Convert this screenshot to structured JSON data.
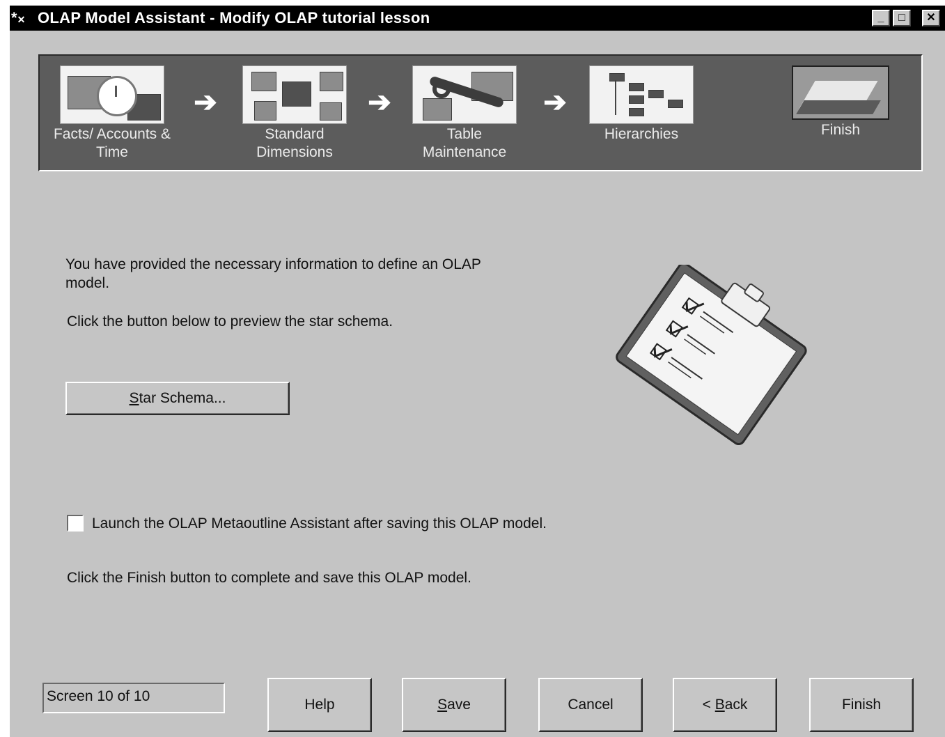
{
  "window": {
    "title": "OLAP Model Assistant - Modify OLAP tutorial lesson",
    "controls": {
      "minimize": "_",
      "maximize": "□",
      "close": "✕"
    }
  },
  "steps": [
    {
      "label": "Facts/ Accounts &\nTime",
      "icon": "facts-accounts-time-icon"
    },
    {
      "label": "Standard\nDimensions",
      "icon": "standard-dimensions-icon"
    },
    {
      "label": "Table\nMaintenance",
      "icon": "table-maintenance-icon"
    },
    {
      "label": "Hierarchies",
      "icon": "hierarchies-icon"
    },
    {
      "label": "Finish",
      "icon": "finish-icon"
    }
  ],
  "main": {
    "intro_text": "You have provided the necessary information to define an OLAP model.",
    "preview_text": "Click the button below to preview the star schema.",
    "star_schema_button": {
      "prefix": "S",
      "label": "tar Schema..."
    },
    "launch_checkbox": {
      "checked": false,
      "label": "Launch the OLAP Metaoutline Assistant after saving this OLAP model."
    },
    "finish_text": "Click the Finish button to complete and save this OLAP model."
  },
  "footer": {
    "status": "Screen 10 of 10",
    "buttons": {
      "help": "Help",
      "save_prefix": "S",
      "save_rest": "ave",
      "cancel": "Cancel",
      "back_lead": "< ",
      "back_accel": "B",
      "back_rest": "ack",
      "finish": "Finish"
    }
  }
}
